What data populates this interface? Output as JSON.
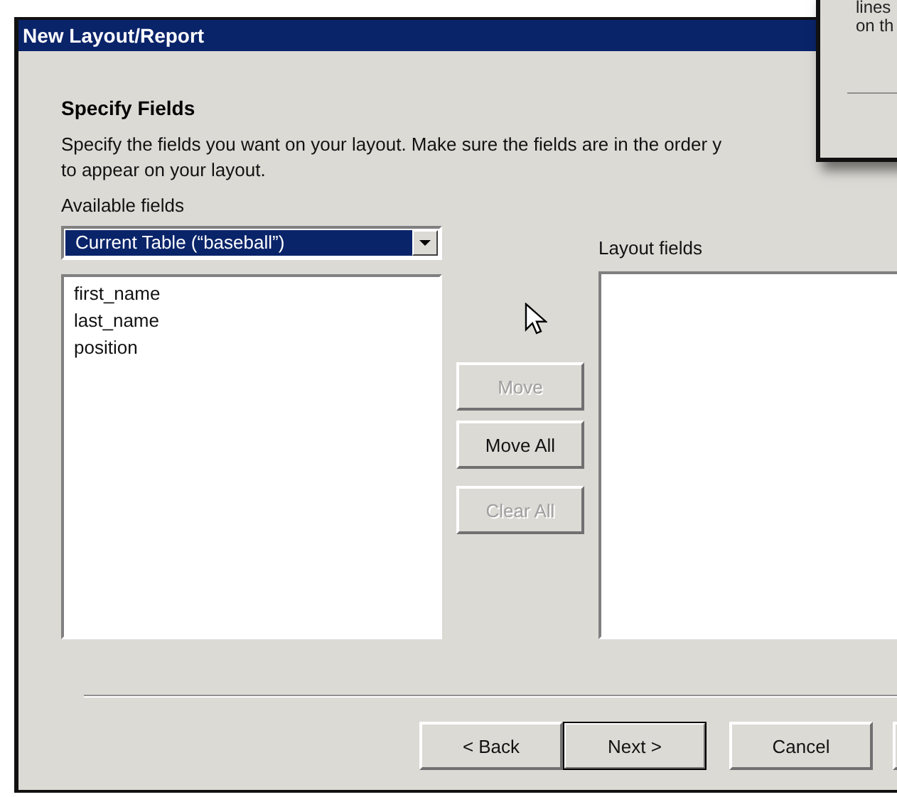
{
  "window": {
    "title": "New Layout/Report"
  },
  "heading": "Specify Fields",
  "description_lines": [
    "Specify the fields you want on your layout. Make sure the fields are in the order y",
    "to appear on your layout."
  ],
  "available_fields": {
    "label": "Available fields",
    "dropdown": {
      "value": "Current Table (“baseball”)"
    },
    "items": [
      {
        "label": "first_name",
        "selected": false
      },
      {
        "label": "last_name",
        "selected": false
      },
      {
        "label": "position",
        "selected": false
      }
    ]
  },
  "move_buttons": [
    {
      "label": "Move",
      "disabled": true
    },
    {
      "label": "Move All",
      "disabled": false
    },
    {
      "label": "Clear All",
      "disabled": true
    }
  ],
  "layout_fields": {
    "label": "Layout fields"
  },
  "footer_buttons": [
    {
      "label": "< Back",
      "default": false
    },
    {
      "label": "Next >",
      "default": true
    },
    {
      "label": "Cancel",
      "default": false
    }
  ],
  "overlay_window": {
    "lines": [
      "lines",
      "on th"
    ]
  }
}
